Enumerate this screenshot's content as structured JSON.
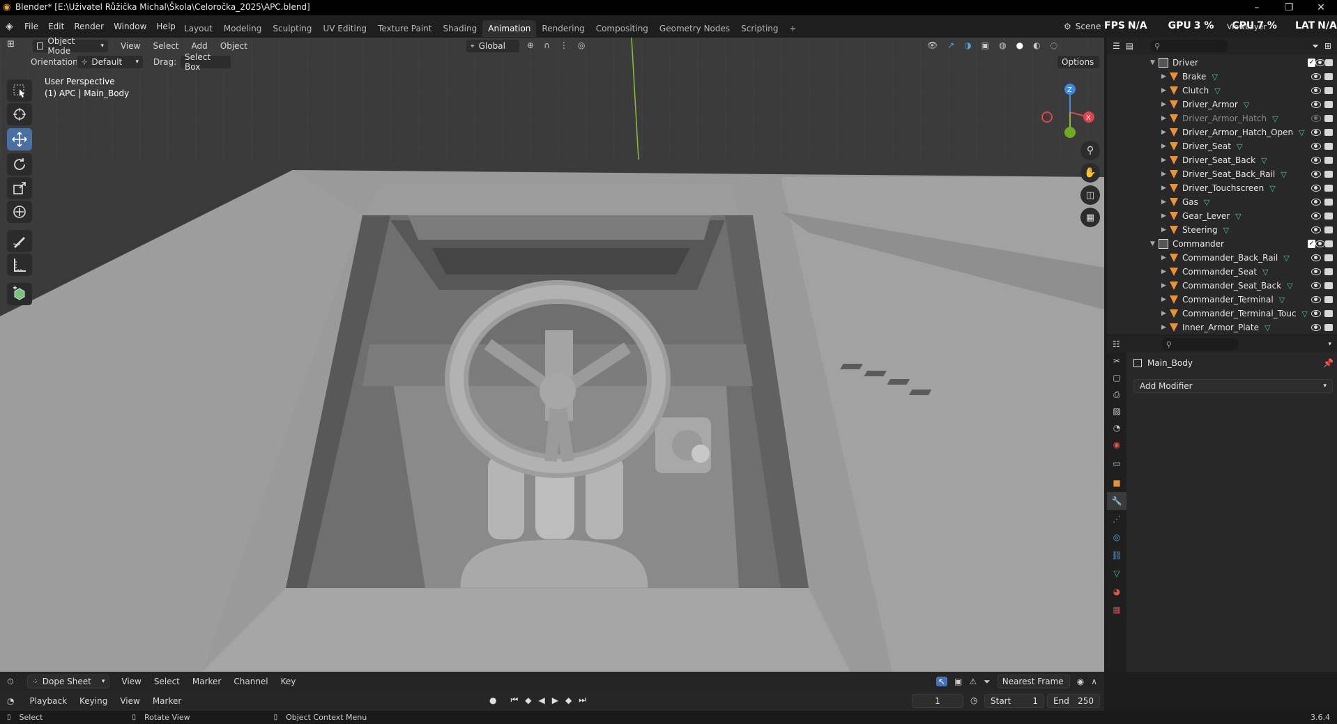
{
  "window": {
    "title": "Blender* [E:\\Uživatel Růžička Michal\\Škola\\Celoročka_2025\\APC.blend]",
    "minimize": "–",
    "restore": "❐",
    "close": "✕"
  },
  "menu": [
    "File",
    "Edit",
    "Render",
    "Window",
    "Help"
  ],
  "workspaces": [
    "Layout",
    "Modeling",
    "Sculpting",
    "UV Editing",
    "Texture Paint",
    "Shading",
    "Animation",
    "Rendering",
    "Compositing",
    "Geometry Nodes",
    "Scripting"
  ],
  "active_workspace": "Animation",
  "add_workspace": "+",
  "scene_label": "Scene",
  "viewlayer_label": "ViewLayer",
  "stats": {
    "fps_label": "FPS",
    "fps_value": "N/A",
    "gpu_label": "GPU",
    "gpu_value": "3 %",
    "cpu_label": "CPU",
    "cpu_value": "7 %",
    "lat_label": "LAT",
    "lat_value": "N/A"
  },
  "viewport_header": {
    "mode": "Object Mode",
    "menus": [
      "View",
      "Select",
      "Add",
      "Object"
    ],
    "transform": "Global"
  },
  "tool_header": {
    "orientation_label": "Orientation:",
    "orientation_value": "Default",
    "drag_label": "Drag:",
    "drag_value": "Select Box",
    "options": "Options"
  },
  "viewport_overlay": {
    "perspective": "User Perspective",
    "object": "(1) APC | Main_Body"
  },
  "gizmo": {
    "z": "Z",
    "x": "X",
    "y": "Y"
  },
  "outliner": {
    "rows": [
      {
        "name": "Driver",
        "type": "collection",
        "indent": 0
      },
      {
        "name": "Brake",
        "type": "mesh",
        "indent": 1
      },
      {
        "name": "Clutch",
        "type": "mesh",
        "indent": 1
      },
      {
        "name": "Driver_Armor",
        "type": "mesh",
        "indent": 1
      },
      {
        "name": "Driver_Armor_Hatch",
        "type": "mesh",
        "indent": 1,
        "hidden": true
      },
      {
        "name": "Driver_Armor_Hatch_Open",
        "type": "mesh",
        "indent": 1
      },
      {
        "name": "Driver_Seat",
        "type": "mesh",
        "indent": 1
      },
      {
        "name": "Driver_Seat_Back",
        "type": "mesh",
        "indent": 1
      },
      {
        "name": "Driver_Seat_Back_Rail",
        "type": "mesh",
        "indent": 1
      },
      {
        "name": "Driver_Touchscreen",
        "type": "mesh",
        "indent": 1
      },
      {
        "name": "Gas",
        "type": "mesh",
        "indent": 1
      },
      {
        "name": "Gear_Lever",
        "type": "mesh",
        "indent": 1
      },
      {
        "name": "Steering",
        "type": "mesh",
        "indent": 1
      },
      {
        "name": "Commander",
        "type": "collection",
        "indent": 0
      },
      {
        "name": "Commander_Back_Rail",
        "type": "mesh",
        "indent": 1
      },
      {
        "name": "Commander_Seat",
        "type": "mesh",
        "indent": 1
      },
      {
        "name": "Commander_Seat_Back",
        "type": "mesh",
        "indent": 1
      },
      {
        "name": "Commander_Terminal",
        "type": "mesh",
        "indent": 1
      },
      {
        "name": "Commander_Terminal_Touc",
        "type": "mesh",
        "indent": 1
      },
      {
        "name": "Inner_Armor_Plate",
        "type": "mesh",
        "indent": 1
      }
    ]
  },
  "properties": {
    "object_name": "Main_Body",
    "add_modifier": "Add Modifier"
  },
  "timeline": {
    "editor": "Dope Sheet",
    "menus": [
      "View",
      "Select",
      "Marker",
      "Channel",
      "Key"
    ],
    "snap": "Nearest Frame",
    "playback": "Playback",
    "keying": "Keying",
    "view": "View",
    "marker": "Marker",
    "current_frame": "1",
    "start_label": "Start",
    "start_value": "1",
    "end_label": "End",
    "end_value": "250"
  },
  "status": {
    "select": "Select",
    "rotate": "Rotate View",
    "context": "Object Context Menu",
    "version": "3.6.4"
  },
  "colors": {
    "accent": "#4772b3",
    "mesh_icon": "#e8913a",
    "vertex_group": "#3fd48a",
    "workspace_active": "#303030"
  }
}
